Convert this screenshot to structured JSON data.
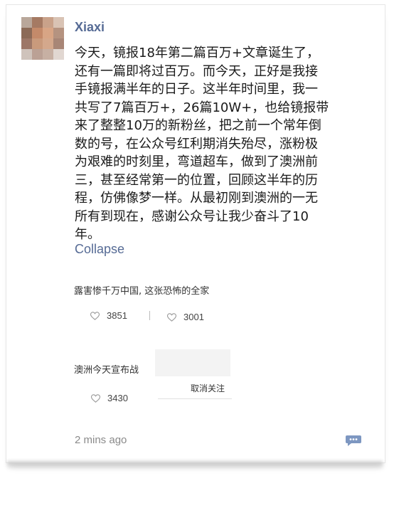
{
  "post": {
    "username": "Xiaxi",
    "text": "今天，镜报18年第二篇百万+文章诞生了，还有一篇即将过百万。而今天，正好是我接手镜报满半年的日子。这半年时间里，我一共写了7篇百万+，26篇10W+，也给镜报带来了整整10万的新粉丝，把之前一个常年倒数的号，在公众号红利期消失殆尽，涨粉极为艰难的时刻里，弯道超车，做到了澳洲前三，甚至经常第一的位置，回顾这半年的历程，仿佛像梦一样。从最初刚到澳洲的一无所有到现在，感谢公众号让我少奋斗了10年。",
    "lines": [
      "今天，镜报18年第二篇百万+文章诞生了，",
      "还有一篇即将过百万。而今天，正好是我接",
      "手镜报满半年的日子。这半年时间里，我一",
      "共写了7篇百万+，26篇10W+，也给镜报带",
      "来了整整10万的新粉丝，把之前一个常年倒",
      "数的号，在公众号红利期消失殆尽，涨粉极",
      "为艰难的时刻里，弯道超车，做到了澳洲前",
      "三，甚至经常第一的位置，回顾这半年的历",
      "程，仿佛像梦一样。从最初刚到澳洲的一无",
      "所有到现在，感谢公众号让我少奋斗了10",
      "年。"
    ],
    "collapse_label": "Collapse",
    "timestamp": "2 mins ago"
  },
  "embeds": [
    {
      "title": "露害惨千万中国, 这张恐怖的全家",
      "likes": [
        "3851",
        "3001"
      ]
    },
    {
      "title": "澳洲今天宣布战",
      "likes": [
        "3430"
      ],
      "unfollow": "取消关注"
    }
  ],
  "colors": {
    "link": "#566b95",
    "text": "#1a1a1a",
    "muted": "#8a8a8a",
    "comment_icon": "#7d97c1"
  },
  "icons": {
    "avatar": "pixelated-avatar",
    "like": "heart-outline-icon",
    "comment": "comment-bubble-icon"
  }
}
